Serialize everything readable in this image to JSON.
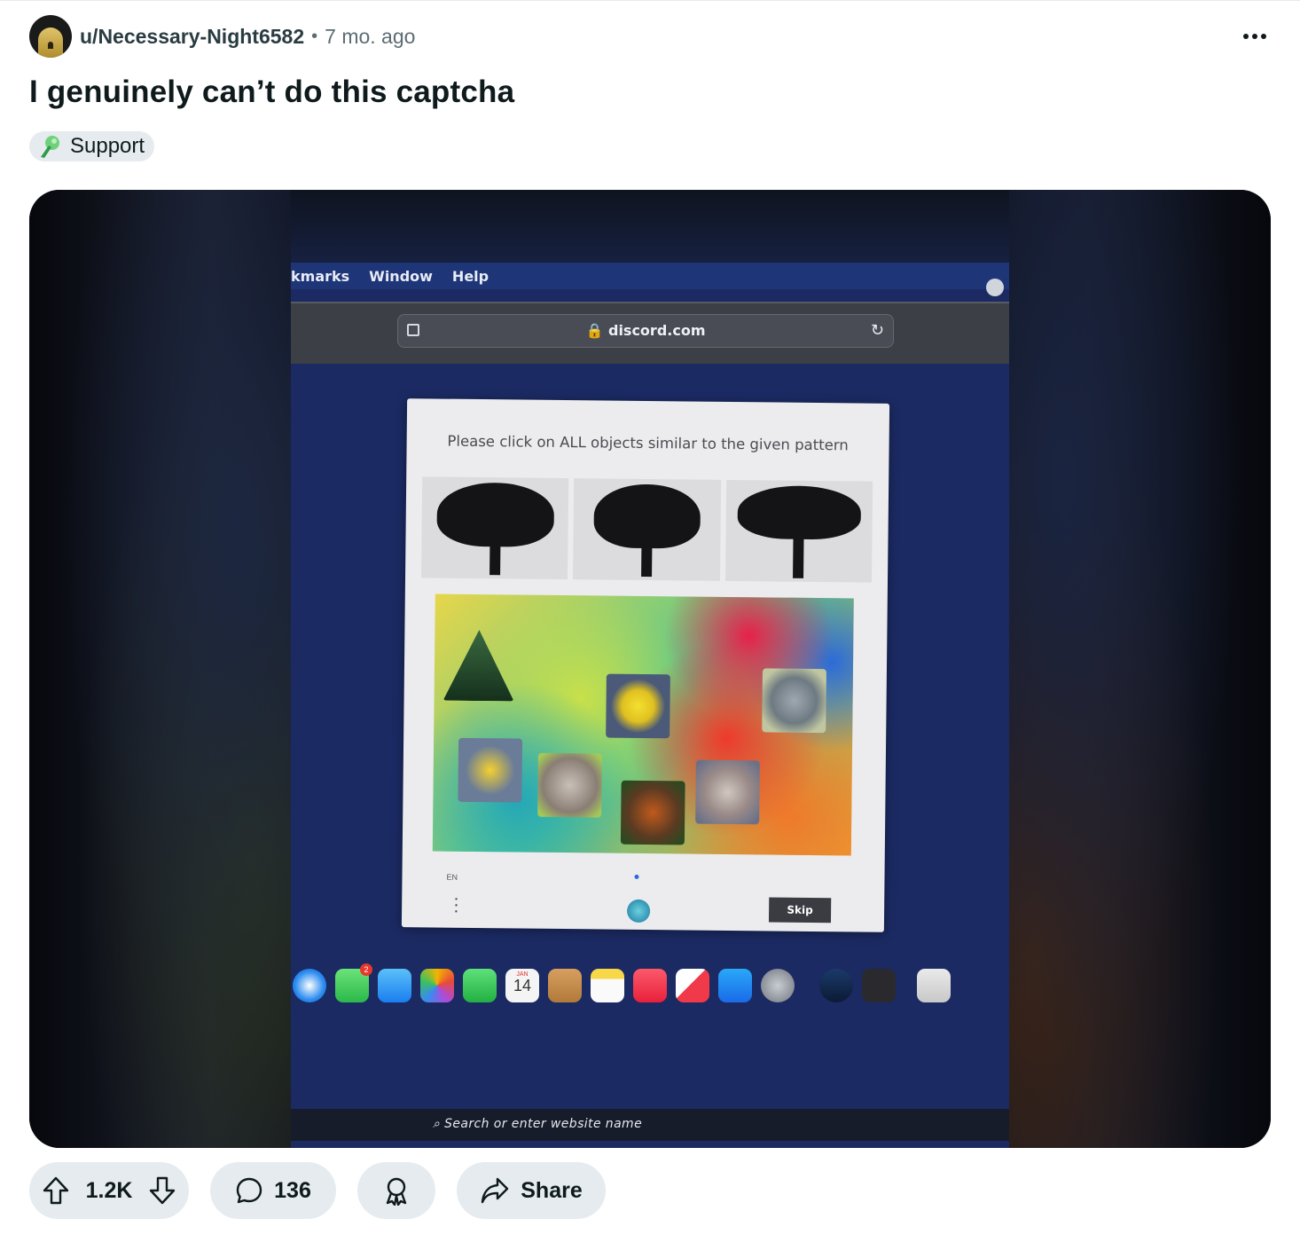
{
  "post": {
    "author": "u/Necessary-Night6582",
    "separator": "•",
    "age": "7 mo. ago",
    "title": "I genuinely can’t do this captcha",
    "flair": "Support"
  },
  "media": {
    "menu_items": [
      "kmarks",
      "Window",
      "Help"
    ],
    "url": "discord.com",
    "captcha_prompt": "Please click on ALL objects similar to the given pattern",
    "captcha_lang": "EN",
    "captcha_skip": "Skip",
    "calendar_month": "JAN",
    "calendar_day": "14",
    "touchbar_search": "Search or enter website name",
    "messages_badge": "2"
  },
  "actions": {
    "votes": "1.2K",
    "comments": "136",
    "share": "Share"
  },
  "colors": {
    "pill_bg": "#e5ebee",
    "text": "#0f1a1c",
    "meta": "#5c6c74"
  },
  "icons": [
    "more-icon",
    "flair-icon",
    "upvote-icon",
    "downvote-icon",
    "comment-icon",
    "award-icon",
    "share-icon"
  ]
}
